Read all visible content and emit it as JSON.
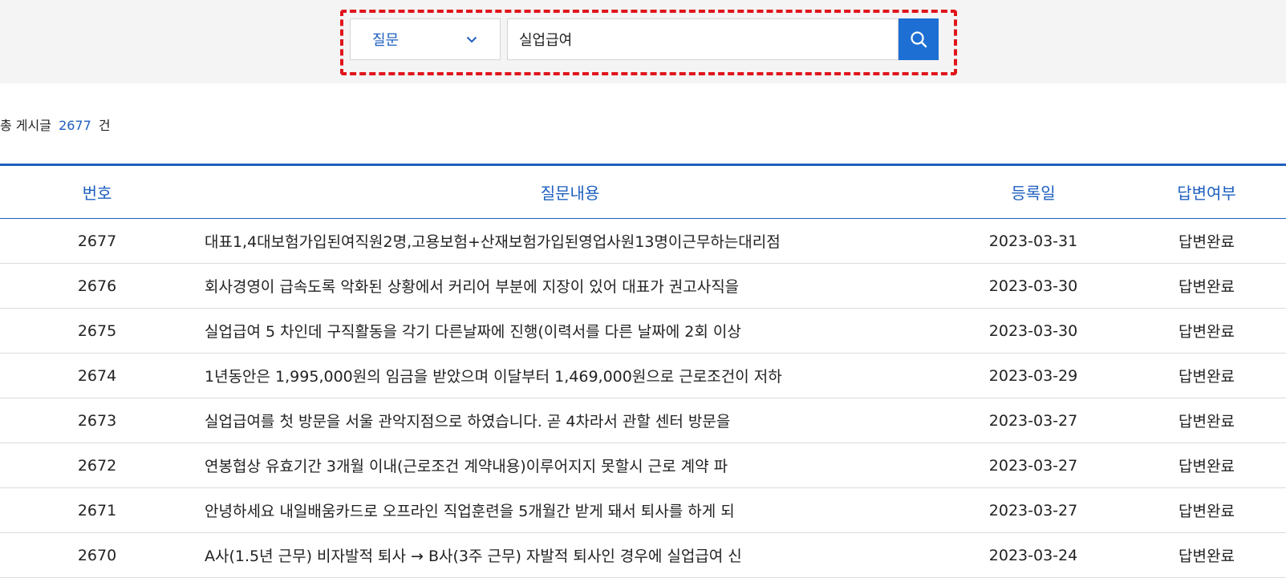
{
  "search": {
    "category": "질문",
    "query": "실업급여",
    "button_icon": "search-icon",
    "accent_color": "#1d6fd4",
    "highlight_color": "#e0151c"
  },
  "summary": {
    "prefix": "총 게시글",
    "count": "2677",
    "suffix": "건"
  },
  "table": {
    "headers": [
      "번호",
      "질문내용",
      "등록일",
      "답변여부"
    ],
    "rows": [
      {
        "no": "2677",
        "title": "대표1,4대보험가입된여직원2명,고용보험+산재보험가입된영업사원13명이근무하는대리점",
        "date": "2023-03-31",
        "status": "답변완료"
      },
      {
        "no": "2676",
        "title": "회사경영이 급속도록 악화된 상황에서 커리어 부분에 지장이 있어 대표가 권고사직을",
        "date": "2023-03-30",
        "status": "답변완료"
      },
      {
        "no": "2675",
        "title": "실업급여 5 차인데 구직활동을 각기 다른날짜에 진행(이력서를 다른 날짜에 2회 이상",
        "date": "2023-03-30",
        "status": "답변완료"
      },
      {
        "no": "2674",
        "title": "1년동안은 1,995,000원의 임금을 받았으며 이달부터 1,469,000원으로 근로조건이 저하",
        "date": "2023-03-29",
        "status": "답변완료"
      },
      {
        "no": "2673",
        "title": "실업급여를 첫 방문을 서울 관악지점으로 하였습니다. 곧 4차라서 관할 센터 방문을",
        "date": "2023-03-27",
        "status": "답변완료"
      },
      {
        "no": "2672",
        "title": "연봉협상 유효기간 3개월 이내(근로조건 계약내용)이루어지지 못할시 근로 계약 파",
        "date": "2023-03-27",
        "status": "답변완료"
      },
      {
        "no": "2671",
        "title": "안녕하세요 내일배움카드로 오프라인 직업훈련을 5개월간 받게 돼서 퇴사를 하게 되",
        "date": "2023-03-27",
        "status": "답변완료"
      },
      {
        "no": "2670",
        "title": "A사(1.5년 근무) 비자발적 퇴사 → B사(3주 근무) 자발적 퇴사인 경우에 실업급여 신",
        "date": "2023-03-24",
        "status": "답변완료"
      }
    ]
  }
}
